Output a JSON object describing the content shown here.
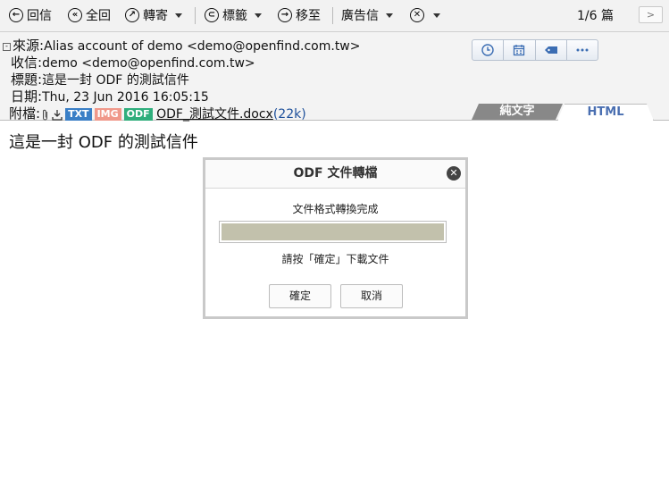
{
  "toolbar": {
    "reply": "回信",
    "reply_all": "全回",
    "forward": "轉寄",
    "tag": "標籤",
    "move": "移至",
    "spam": "廣告信",
    "pager": "1/6 篇",
    "next_glyph": ">"
  },
  "header": {
    "from_label": "來源:",
    "from_value": "Alias account of demo <demo@openfind.com.tw>",
    "to_label": "收信:",
    "to_value": "demo <demo@openfind.com.tw>",
    "subject_label": "標題:",
    "subject_value": "這是一封 ODF 的測試信件",
    "date_label": "日期:",
    "date_value": "Thu, 23 Jun 2016 16:05:15",
    "attach_label": "附檔:",
    "attach_tags": {
      "txt": "TXT",
      "img": "IMG",
      "odf": "ODF"
    },
    "attach_name": "ODF_測試文件.docx",
    "attach_size": "(22k)",
    "tab_plain": "純文字",
    "tab_html": "HTML"
  },
  "body": {
    "text": "這是一封 ODF 的測試信件"
  },
  "dialog": {
    "title": "ODF 文件轉檔",
    "status": "文件格式轉換完成",
    "hint": "請按「確定」下載文件",
    "progress": 1.0,
    "ok": "確定",
    "cancel": "取消"
  },
  "colors": {
    "progress_fill": "#c2c1ac",
    "tab_active_text": "#4a6fb1",
    "attach_size": "#1d4f9a"
  }
}
